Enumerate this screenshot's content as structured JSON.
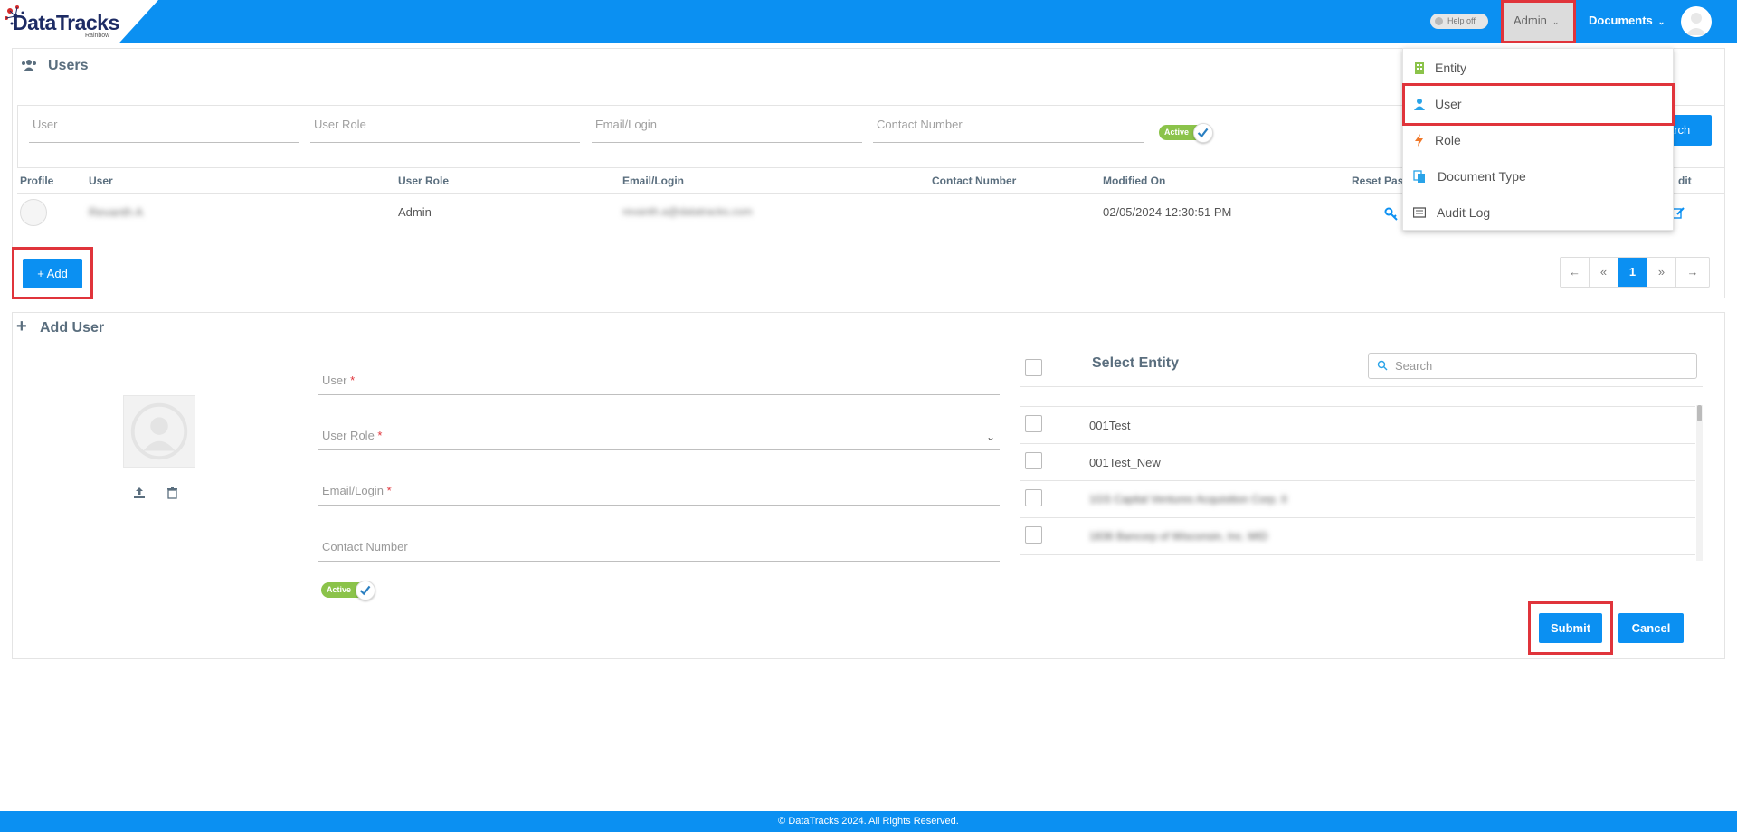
{
  "header": {
    "logo_text": "DataTracks",
    "logo_sub": "Rainbow",
    "help_toggle": "Help off",
    "admin_menu": "Admin",
    "documents_menu": "Documents"
  },
  "admin_dropdown": {
    "items": [
      {
        "label": "Entity",
        "icon": "building-icon",
        "color": "#8bc34a"
      },
      {
        "label": "User",
        "icon": "user-icon",
        "color": "#29a3e8"
      },
      {
        "label": "Role",
        "icon": "bolt-icon",
        "color": "#f0782a"
      },
      {
        "label": "Document Type",
        "icon": "documents-icon",
        "color": "#29a3e8"
      },
      {
        "label": "Audit Log",
        "icon": "log-icon",
        "color": "#555555"
      }
    ]
  },
  "users_panel": {
    "title": "Users",
    "filters": {
      "user": "User",
      "user_role": "User Role",
      "email": "Email/Login",
      "contact": "Contact Number",
      "active_label": "Active",
      "search_button": "arch"
    },
    "columns": [
      "Profile",
      "User",
      "User Role",
      "Email/Login",
      "Contact Number",
      "Modified On",
      "Reset Pas",
      "dit"
    ],
    "rows": [
      {
        "user": "Revanth A",
        "role": "Admin",
        "email": "revanth.a@datatracks.com",
        "contact": "",
        "modified": "02/05/2024 12:30:51 PM"
      }
    ],
    "add_button": "+ Add",
    "pagination": {
      "first": "←",
      "prev": "«",
      "current": "1",
      "next": "»",
      "last": "→"
    }
  },
  "add_user": {
    "title": "Add User",
    "fields": {
      "user": "User",
      "user_role": "User Role",
      "email": "Email/Login",
      "contact": "Contact Number",
      "required_mark": "*"
    },
    "active_label": "Active",
    "entity": {
      "title": "Select Entity",
      "search_placeholder": "Search",
      "items": [
        "001Test",
        "001Test_New",
        "1GS Capital Ventures Acquisition Corp. II",
        "1836 Bancorp of Wisconsin, Inc. MID"
      ]
    },
    "submit_button": "Submit",
    "cancel_button": "Cancel"
  },
  "footer": {
    "text": "© DataTracks 2024. All Rights Reserved."
  }
}
